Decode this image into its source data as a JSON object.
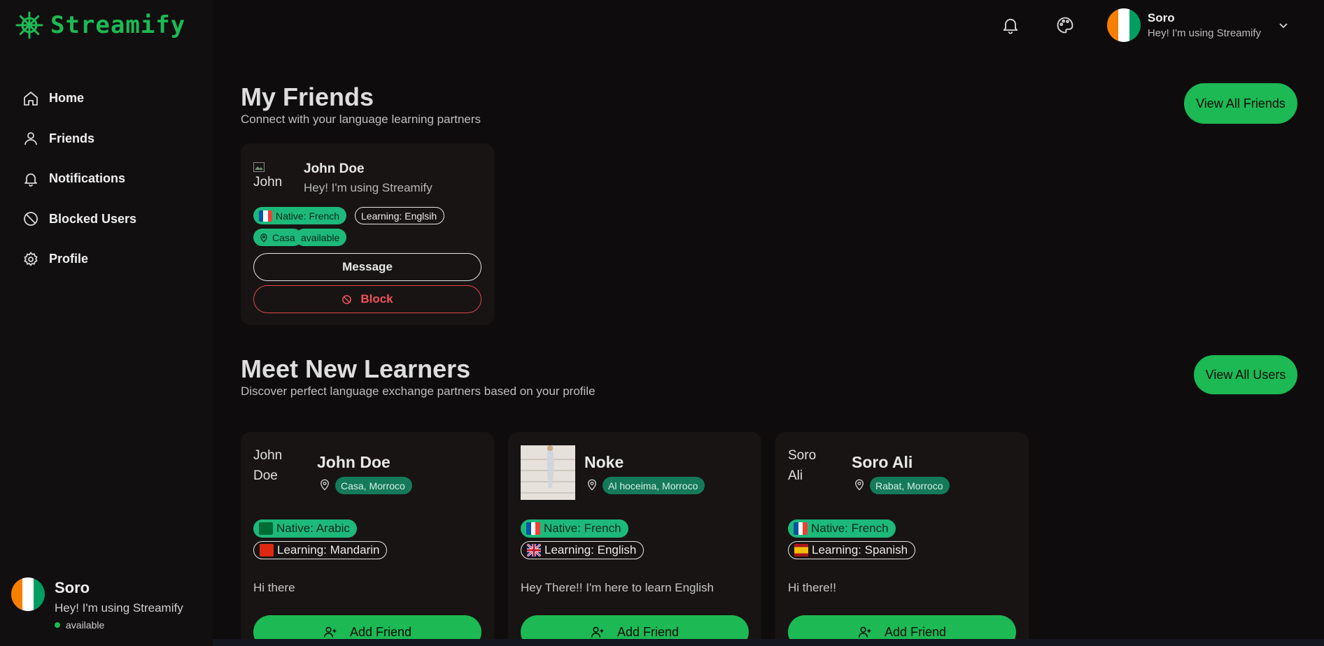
{
  "brand": {
    "name": "Streamify",
    "accent": "#1db954"
  },
  "sidebar": {
    "items": [
      {
        "label": "Home",
        "icon": "home-icon"
      },
      {
        "label": "Friends",
        "icon": "user-icon"
      },
      {
        "label": "Notifications",
        "icon": "bell-icon"
      },
      {
        "label": "Blocked Users",
        "icon": "ban-icon"
      },
      {
        "label": "Profile",
        "icon": "gear-icon"
      }
    ],
    "user": {
      "name": "Soro",
      "status": "Hey! I'm using Streamify",
      "availability": "available"
    }
  },
  "header": {
    "user": {
      "name": "Soro",
      "status": "Hey! I'm using Streamify"
    }
  },
  "friends_section": {
    "title": "My Friends",
    "subtitle": "Connect with your language learning partners",
    "view_all": "View All Friends",
    "cards": [
      {
        "avatar_alt": "John",
        "name": "John Doe",
        "status": "Hey! I'm using Streamify",
        "native": "Native: French",
        "learning": "Learning: Englsih",
        "location": "Casa",
        "availability": "available",
        "message_label": "Message",
        "block_label": "Block"
      }
    ]
  },
  "learners_section": {
    "title": "Meet New Learners",
    "subtitle": "Discover perfect language exchange partners based on your profile",
    "view_all": "View All Users",
    "cards": [
      {
        "avatar_alt": "John Doe",
        "name": "John Doe",
        "location": "Casa, Morroco",
        "native": "Native: Arabic",
        "learning": "Learning: Mandarin",
        "bio": "Hi there",
        "add_label": "Add Friend"
      },
      {
        "avatar_alt": "",
        "name": "Noke",
        "location": "Al hoceima, Morroco",
        "native": "Native: French",
        "learning": "Learning: English",
        "bio": "Hey There!! I'm here to learn English",
        "add_label": "Add Friend"
      },
      {
        "avatar_alt": "Soro Ali",
        "name": "Soro Ali",
        "location": "Rabat, Morroco",
        "native": "Native: French",
        "learning": "Learning: Spanish",
        "bio": "Hi there!!",
        "add_label": "Add Friend"
      }
    ]
  }
}
